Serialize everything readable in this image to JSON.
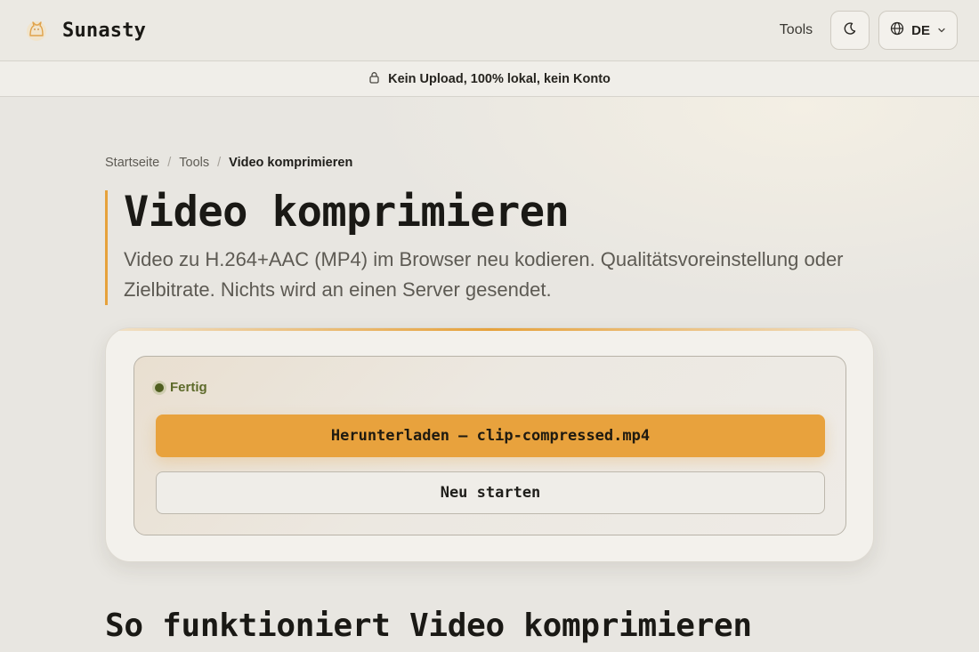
{
  "header": {
    "brand_name": "Sunasty",
    "logo_icon": "cat-logo-icon",
    "nav_tools": "Tools",
    "theme_toggle_icon": "moon-icon",
    "language": {
      "icon": "globe-icon",
      "selected": "DE",
      "chevron_icon": "chevron-down-icon"
    }
  },
  "banner": {
    "icon": "lock-icon",
    "text": "Kein Upload, 100% lokal, kein Konto"
  },
  "breadcrumb": {
    "items": [
      "Startseite",
      "Tools",
      "Video komprimieren"
    ],
    "separator": "/"
  },
  "hero": {
    "title": "Video komprimieren",
    "description": "Video zu H.264+AAC (MP4) im Browser neu kodieren. Qualitätsvoreinstellung oder Zielbitrate. Nichts wird an einen Server gesendet."
  },
  "result": {
    "status_label": "Fertig",
    "download_label": "Herunterladen — clip-compressed.mp4",
    "restart_label": "Neu starten"
  },
  "how_it_works": {
    "title": "So funktioniert Video komprimieren"
  },
  "colors": {
    "accent": "#e8a23d",
    "background": "#e8e6e1",
    "status_green": "#5d6a2a"
  }
}
